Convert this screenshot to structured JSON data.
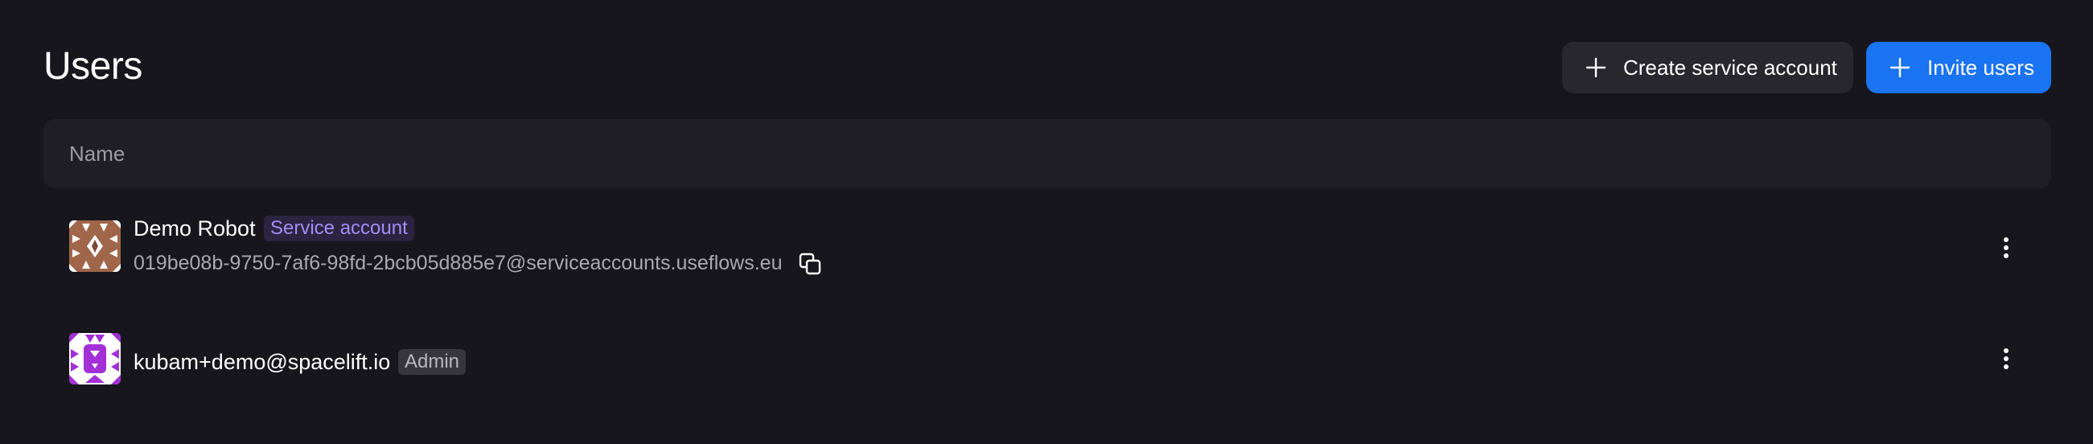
{
  "header": {
    "title": "Users",
    "create_service_account_label": "Create service account",
    "invite_users_label": "Invite users"
  },
  "table": {
    "columns": [
      "Name"
    ],
    "rows": [
      {
        "name": "Demo Robot",
        "badge": "Service account",
        "email": "019be08b-9750-7af6-98fd-2bcb05d885e7@serviceaccounts.useflows.eu",
        "avatar_color": "#a0664a"
      },
      {
        "name": "kubam+demo@spacelift.io",
        "badge": "Admin",
        "avatar_color": "#a230d6"
      }
    ]
  },
  "icons": {
    "plus": "plus-icon",
    "copy": "copy-icon",
    "more": "more-vertical-icon"
  },
  "colors": {
    "background": "#17161c",
    "primary": "#1a73f0",
    "service_badge_text": "#a58cf5"
  }
}
